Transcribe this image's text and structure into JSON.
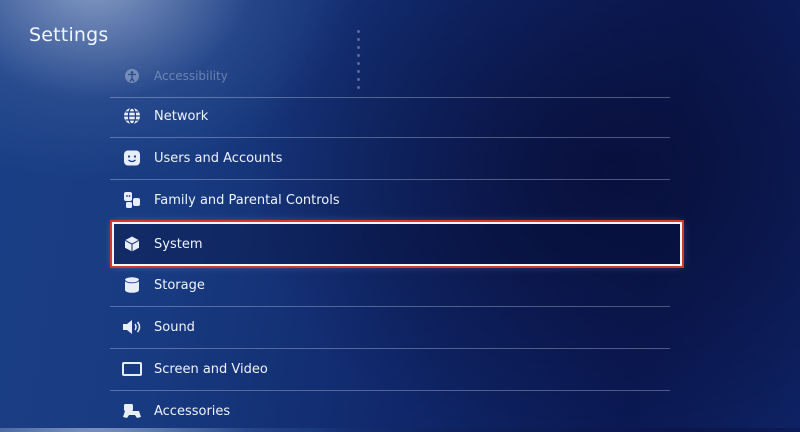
{
  "header": {
    "title": "Settings"
  },
  "menu": {
    "items": [
      {
        "label": "Accessibility",
        "icon": "accessibility-icon"
      },
      {
        "label": "Network",
        "icon": "globe-icon"
      },
      {
        "label": "Users and Accounts",
        "icon": "user-face-icon"
      },
      {
        "label": "Family and Parental Controls",
        "icon": "family-icon"
      },
      {
        "label": "System",
        "icon": "cube-icon",
        "selected": true
      },
      {
        "label": "Storage",
        "icon": "database-icon"
      },
      {
        "label": "Sound",
        "icon": "speaker-icon"
      },
      {
        "label": "Screen and Video",
        "icon": "monitor-icon"
      },
      {
        "label": "Accessories",
        "icon": "controller-icon"
      }
    ]
  },
  "colors": {
    "highlight_border": "#d23a2c",
    "background": "#132e72",
    "text": "#eef3fb"
  }
}
